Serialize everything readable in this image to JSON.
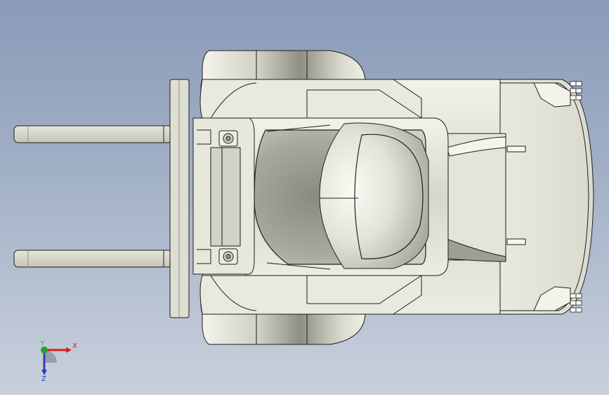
{
  "viewport": {
    "background_top": "#8a9bb8",
    "background_bottom": "#c9d0dc"
  },
  "model": {
    "body_fill": "#d8d8cc",
    "shadow_fill": "#8e8e82",
    "edge_color": "#1e1e1e"
  },
  "triad": {
    "x_label": "X",
    "y_label": "Y",
    "z_label": "Z",
    "x_color": "#d81e1e",
    "y_color": "#2aa02a",
    "z_color": "#2a3fbf"
  }
}
